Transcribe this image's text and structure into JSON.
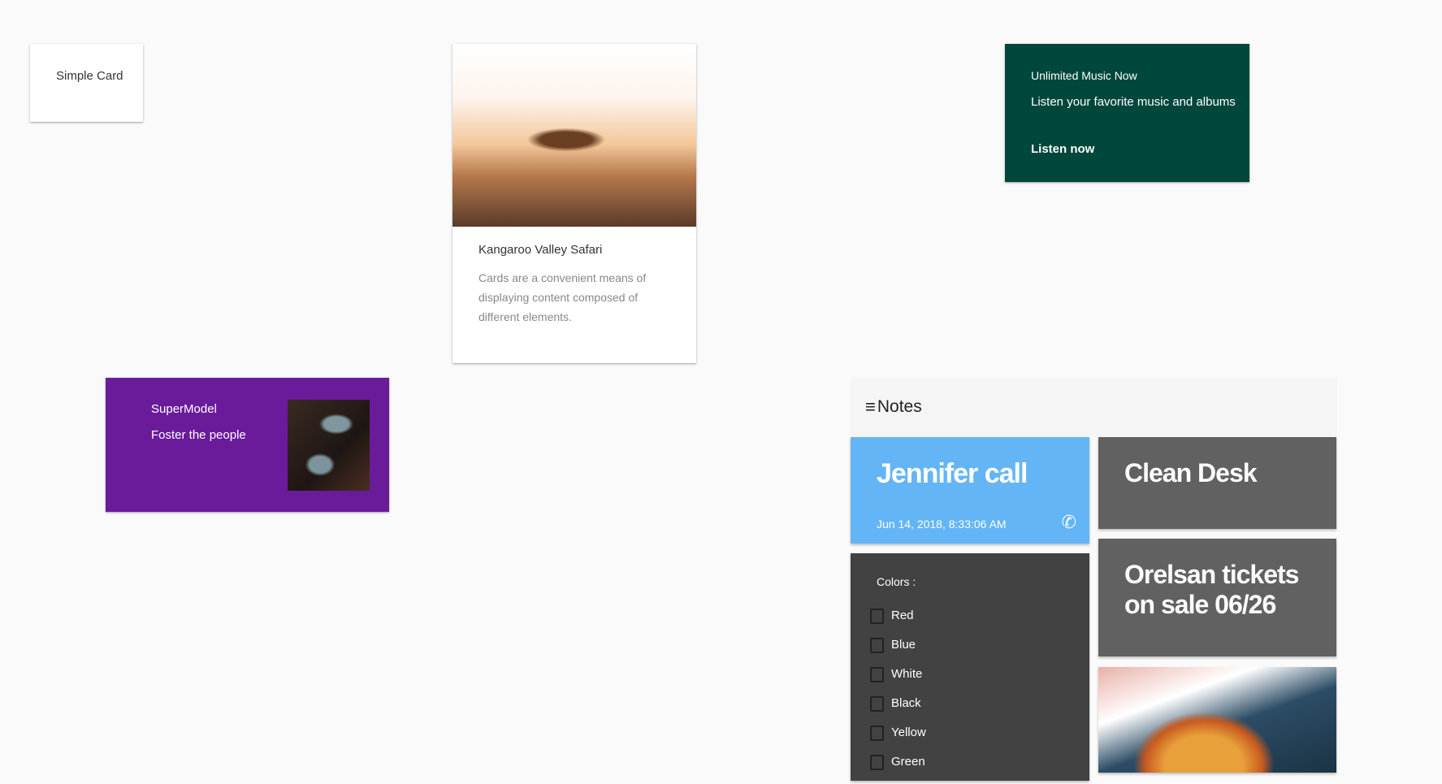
{
  "simple_card": {
    "label": "Simple Card"
  },
  "kangaroo_card": {
    "title": "Kangaroo Valley Safari",
    "description": "Cards are a convenient means of displaying content composed of different elements."
  },
  "music_card": {
    "title": "Unlimited Music Now",
    "subtitle": "Listen your favorite music and albums",
    "action": "Listen now",
    "color": "#00473b"
  },
  "model_card": {
    "title": "SuperModel",
    "subtitle": "Foster the people",
    "color": "#6a1b9a"
  },
  "notes": {
    "header": "Notes",
    "menu_icon": "≡",
    "jennifer": {
      "title": "Jennifer call",
      "date": "Jun 14, 2018, 8:33:06 AM",
      "icon": "✆",
      "color": "#64b5f6"
    },
    "clean_desk": {
      "title": "Clean Desk"
    },
    "orelsan": {
      "title": "Orelsan tickets on sale 06/26"
    },
    "colors": {
      "title": "Colors :",
      "items": [
        "Red",
        "Blue",
        "White",
        "Black",
        "Yellow",
        "Green"
      ]
    }
  }
}
